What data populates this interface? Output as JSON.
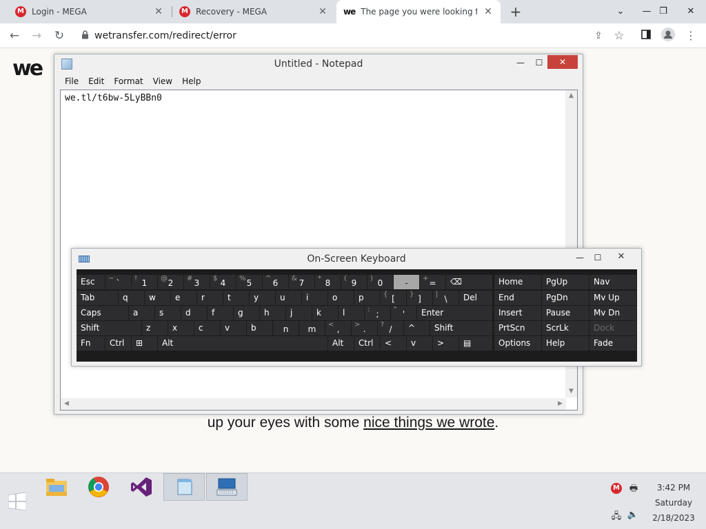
{
  "browser": {
    "tabs": [
      {
        "title": "Login - MEGA",
        "favicon": "mega-icon"
      },
      {
        "title": "Recovery - MEGA",
        "favicon": "mega-icon"
      },
      {
        "title": "The page you were looking for d",
        "favicon": "wetransfer-icon"
      }
    ],
    "url": "wetransfer.com/redirect/error",
    "mega_letter": "M",
    "we_letters": "we"
  },
  "page": {
    "logo": "we",
    "text_before": "up your eyes with some ",
    "link_text": "nice things we wrote",
    "text_after": "."
  },
  "notepad": {
    "title": "Untitled - Notepad",
    "menu": [
      "File",
      "Edit",
      "Format",
      "View",
      "Help"
    ],
    "content": "we.tl/t6bw-5LyBBn0"
  },
  "osk": {
    "title": "On-Screen Keyboard",
    "keys": [
      {
        "main": "Esc"
      },
      {
        "main": "`",
        "shift": "~"
      },
      {
        "main": "1",
        "shift": "!"
      },
      {
        "main": "2",
        "shift": "@"
      },
      {
        "main": "3",
        "shift": "#"
      },
      {
        "main": "4",
        "shift": "$"
      },
      {
        "main": "5",
        "shift": "%"
      },
      {
        "main": "6",
        "shift": "^"
      },
      {
        "main": "7",
        "shift": "&"
      },
      {
        "main": "8",
        "shift": "*"
      },
      {
        "main": "9",
        "shift": "("
      },
      {
        "main": "0",
        "shift": ")"
      },
      {
        "main": "-",
        "shift": "_"
      },
      {
        "main": "=",
        "shift": "+"
      },
      {
        "main": "⌫"
      },
      {
        "main": "Home"
      },
      {
        "main": "PgUp"
      },
      {
        "main": "Nav"
      },
      {
        "main": "Tab"
      },
      {
        "main": "q"
      },
      {
        "main": "w"
      },
      {
        "main": "e"
      },
      {
        "main": "r"
      },
      {
        "main": "t"
      },
      {
        "main": "y"
      },
      {
        "main": "u"
      },
      {
        "main": "i"
      },
      {
        "main": "o"
      },
      {
        "main": "p"
      },
      {
        "main": "[",
        "shift": "{"
      },
      {
        "main": "]",
        "shift": "}"
      },
      {
        "main": "\\",
        "shift": "|"
      },
      {
        "main": "Del"
      },
      {
        "main": "End"
      },
      {
        "main": "PgDn"
      },
      {
        "main": "Mv Up"
      },
      {
        "main": "Caps"
      },
      {
        "main": "a"
      },
      {
        "main": "s"
      },
      {
        "main": "d"
      },
      {
        "main": "f"
      },
      {
        "main": "g"
      },
      {
        "main": "h"
      },
      {
        "main": "j"
      },
      {
        "main": "k"
      },
      {
        "main": "l"
      },
      {
        "main": ";",
        "shift": ":"
      },
      {
        "main": "'",
        "shift": "\""
      },
      {
        "main": "Enter"
      },
      {
        "main": "Insert"
      },
      {
        "main": "Pause"
      },
      {
        "main": "Mv Dn"
      },
      {
        "main": "Shift"
      },
      {
        "main": "z"
      },
      {
        "main": "x"
      },
      {
        "main": "c"
      },
      {
        "main": "v"
      },
      {
        "main": "b"
      },
      {
        "main": "n"
      },
      {
        "main": "m"
      },
      {
        "main": ",",
        "shift": "<"
      },
      {
        "main": ".",
        "shift": ">"
      },
      {
        "main": "/",
        "shift": "?"
      },
      {
        "main": "^"
      },
      {
        "main": "Shift"
      },
      {
        "main": "PrtScn"
      },
      {
        "main": "ScrLk"
      },
      {
        "main": "Dock"
      },
      {
        "main": "Fn"
      },
      {
        "main": "Ctrl"
      },
      {
        "main": "⊞"
      },
      {
        "main": "Alt"
      },
      {
        "main": ""
      },
      {
        "main": "Alt"
      },
      {
        "main": "Ctrl"
      },
      {
        "main": "<"
      },
      {
        "main": "v"
      },
      {
        "main": ">"
      },
      {
        "main": "▤"
      },
      {
        "main": "Options"
      },
      {
        "main": "Help"
      },
      {
        "main": "Fade"
      }
    ]
  },
  "taskbar": {
    "apps": [
      "file-explorer-icon",
      "chrome-icon",
      "visual-studio-icon",
      "notepad-icon",
      "on-screen-keyboard-icon"
    ],
    "clock": {
      "time": "3:42 PM",
      "day": "Saturday",
      "date": "2/18/2023"
    }
  },
  "colors": {
    "accent_red": "#d9272e",
    "osk_key": "#2d2d2f",
    "page_bg": "#fbf9f5"
  }
}
